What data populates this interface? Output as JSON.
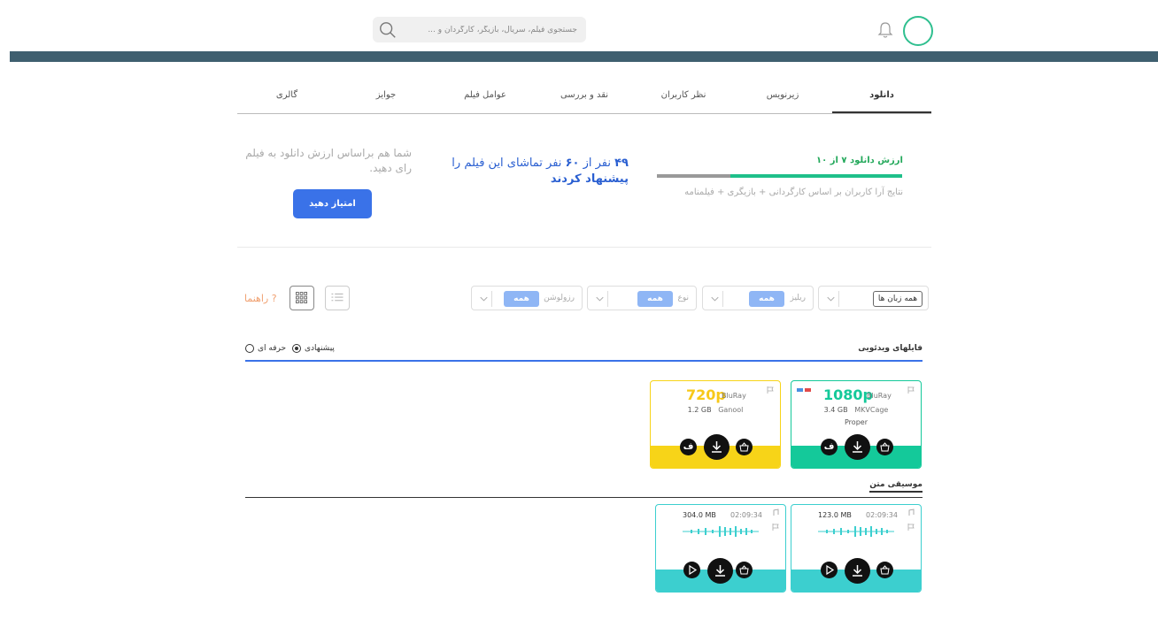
{
  "header": {
    "search_placeholder": "جستجوی فیلم، سریال، بازیگر، کارگردان و ...",
    "search_icon": "search-icon",
    "bell_icon": "bell-icon",
    "accent": "#2fbf8f",
    "banner_color": "#3f5f6f"
  },
  "tabs": [
    {
      "label": "دانلود",
      "active": true
    },
    {
      "label": "زیرنویس"
    },
    {
      "label": "نظر کاربران"
    },
    {
      "label": "نقد و بررسی"
    },
    {
      "label": "عوامل فیلم"
    },
    {
      "label": "جوایز"
    },
    {
      "label": "گالری"
    }
  ],
  "rating": {
    "title": "ارزش دانلود ۷ از ۱۰",
    "value": 7,
    "max": 10,
    "note": "نتایج آرا کاربران بر اساس کارگردانی + بازیگری + فیلمنامه",
    "recommend_count": "۴۹",
    "recommend_mid1": "نفر از",
    "recommend_total": "۶۰",
    "recommend_mid2": "نفر تماشای این فیلم را",
    "recommend_word": "پیشنهاد کردند",
    "suggest_text": "شما هم براساس ارزش دانلود به فیلم رای دهید.",
    "rate_button": "امتیاز دهید",
    "button_color": "#3a72e8"
  },
  "filters": {
    "language": "همه زبان ها",
    "release_label": "ریلیز",
    "release_value": "همه",
    "type_label": "نوع",
    "type_value": "همه",
    "resolution_label": "رزولوشن",
    "resolution_value": "همه",
    "help_label": "راهنما",
    "list_icon": "list-icon",
    "grid_icon": "grid-icon"
  },
  "video_section": {
    "title": "فایلهای ویدئویی",
    "mode_suggested": "پیشنهادی",
    "mode_pro": "حرفه ای",
    "cards": [
      {
        "quality": "1080p",
        "source": "BluRay",
        "size": "3.4 GB",
        "encoder": "MKVCage",
        "extra": "Proper",
        "color": "#14c99a",
        "sub_badge": "ف"
      },
      {
        "quality": "720p",
        "source": "BluRay",
        "size": "1.2 GB",
        "encoder": "Ganool",
        "extra": "",
        "color": "#f7d418",
        "sub_badge": "ف"
      }
    ]
  },
  "music_section": {
    "title": "موسیقی متن",
    "cards": [
      {
        "size": "123.0 MB",
        "duration": "02:09:34"
      },
      {
        "size": "304.0 MB",
        "duration": "02:09:34"
      }
    ],
    "color": "#3ccfcf"
  }
}
